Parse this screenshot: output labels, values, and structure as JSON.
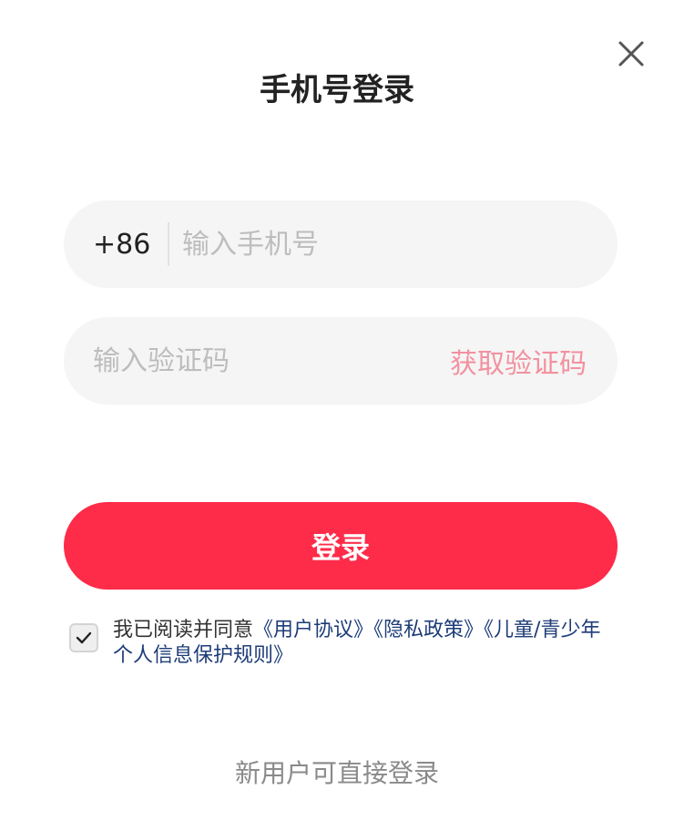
{
  "header": {
    "title": "手机号登录",
    "close_icon": "close-icon"
  },
  "phone_field": {
    "country_code": "+86",
    "value": "",
    "placeholder": "输入手机号"
  },
  "code_field": {
    "value": "",
    "placeholder": "输入验证码",
    "get_code_label": "获取验证码"
  },
  "login_button": {
    "label": "登录"
  },
  "agreement": {
    "checked": true,
    "prefix": "我已阅读并同意",
    "links": [
      "《用户协议》",
      "《隐私政策》",
      "《儿童/青少年个人信息保护规则》"
    ]
  },
  "footer": {
    "tip": "新用户可直接登录"
  },
  "colors": {
    "primary": "#fe2b49",
    "get_code": "#f2919f",
    "link": "#1e3c78",
    "field_bg": "#f5f5f5",
    "placeholder": "#bdbdbd"
  }
}
